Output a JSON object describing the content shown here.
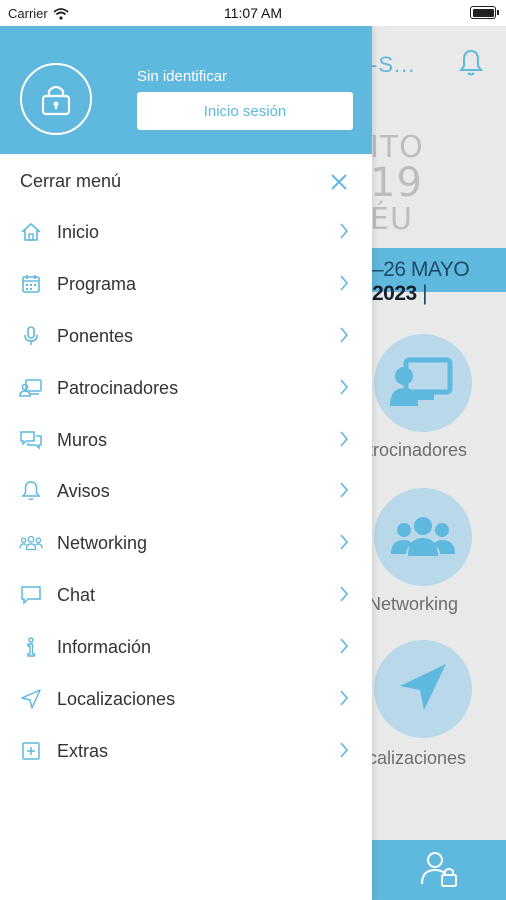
{
  "status_bar": {
    "carrier": "Carrier",
    "time": "11:07 AM"
  },
  "background": {
    "header_title": "-S...",
    "event_lines": [
      "ITO",
      "19",
      "ÉU"
    ],
    "date_strip": {
      "range": "–26 MAYO",
      "year": "2023",
      "tail": "|"
    },
    "tiles": [
      {
        "label": "trocinadores",
        "icon": "presentation-icon"
      },
      {
        "label": "Networking",
        "icon": "group-icon"
      },
      {
        "label": "calizaciones",
        "icon": "navigation-arrow-icon"
      }
    ],
    "footer_icon": "user-lock-icon"
  },
  "drawer": {
    "user_status": "Sin identificar",
    "login_button": "Inicio sesión",
    "close_label": "Cerrar menú",
    "items": [
      {
        "label": "Inicio",
        "icon": "home-icon"
      },
      {
        "label": "Programa",
        "icon": "calendar-icon"
      },
      {
        "label": "Ponentes",
        "icon": "microphone-icon"
      },
      {
        "label": "Patrocinadores",
        "icon": "sponsor-icon"
      },
      {
        "label": "Muros",
        "icon": "chat-bubbles-icon"
      },
      {
        "label": "Avisos",
        "icon": "bell-icon"
      },
      {
        "label": "Networking",
        "icon": "people-icon"
      },
      {
        "label": "Chat",
        "icon": "chat-icon"
      },
      {
        "label": "Información",
        "icon": "info-icon"
      },
      {
        "label": "Localizaciones",
        "icon": "location-arrow-icon"
      },
      {
        "label": "Extras",
        "icon": "plus-square-icon"
      }
    ]
  },
  "colors": {
    "accent": "#5fb8de",
    "text": "#333333",
    "header_text": "#ffffff"
  }
}
